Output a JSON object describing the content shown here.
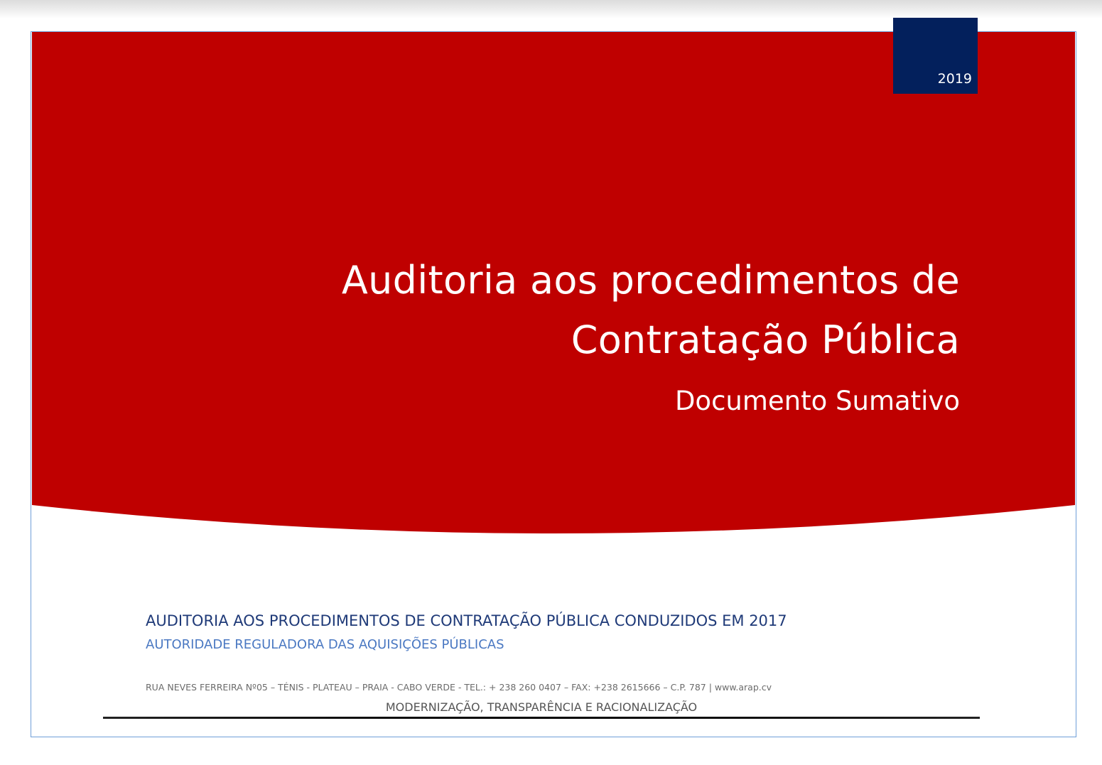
{
  "cover": {
    "year": "2019",
    "title_line1": "Auditoria aos procedimentos de",
    "title_line2": "Contratação Pública",
    "subtitle": "Documento Sumativo",
    "report_heading": "AUDITORIA AOS PROCEDIMENTOS DE CONTRATAÇÃO PÚBLICA CONDUZIDOS EM 2017",
    "authority": "AUTORIDADE REGULADORA DAS AQUISIÇÕES PÚBLICAS",
    "address": "RUA NEVES FERREIRA Nº05 – TÉNIS - PLATEAU – PRAIA - CABO VERDE - TEL.: + 238 260 0407 – FAX: +238 2615666 – C.P. 787 | www.arap.cv",
    "motto": "MODERNIZAÇÃO, TRANSPARÊNCIA E RACIONALIZAÇÃO"
  },
  "colors": {
    "brand_red": "#bf0000",
    "navy": "#03205c",
    "heading_blue": "#1f3a78",
    "authority_blue": "#4a78c2"
  }
}
